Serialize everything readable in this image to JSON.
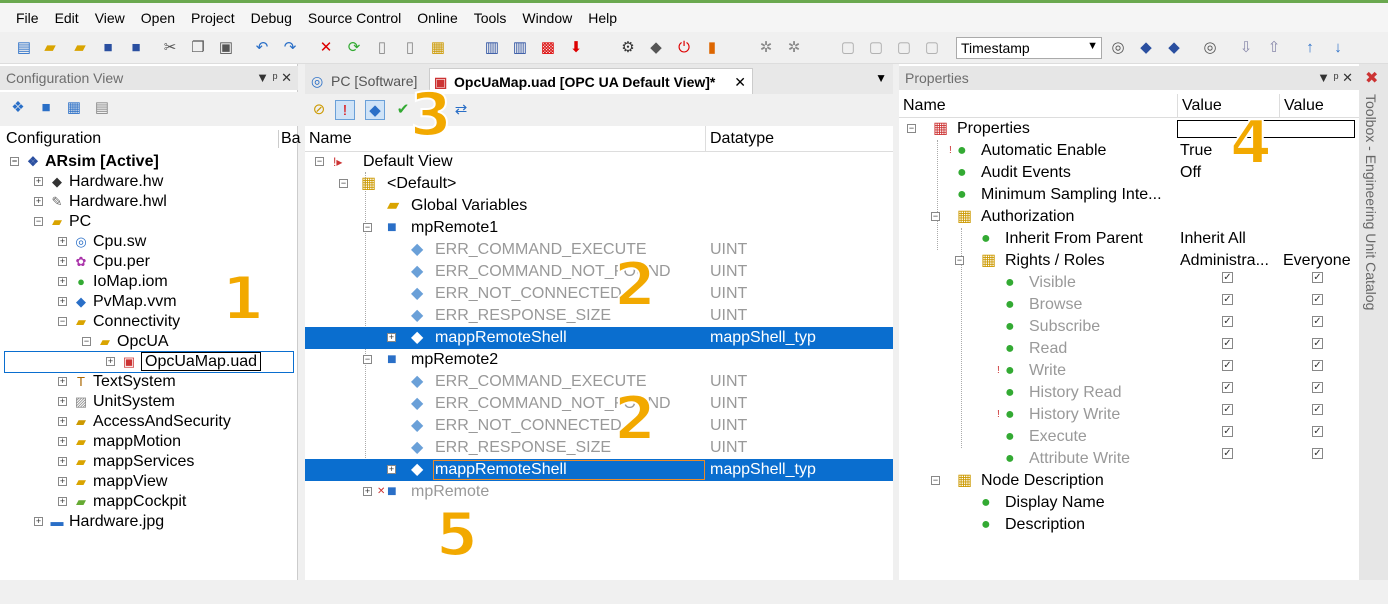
{
  "menu": [
    "File",
    "Edit",
    "View",
    "Open",
    "Project",
    "Debug",
    "Source Control",
    "Online",
    "Tools",
    "Window",
    "Help"
  ],
  "toolbar": {
    "timestamp": "Timestamp"
  },
  "config_view": {
    "title": "Configuration View",
    "col1": "Configuration",
    "col2": "Ba",
    "items": [
      {
        "label": "ARsim [Active]",
        "bold": true
      },
      {
        "label": "Hardware.hw"
      },
      {
        "label": "Hardware.hwl"
      },
      {
        "label": "PC"
      },
      {
        "label": "Cpu.sw"
      },
      {
        "label": "Cpu.per"
      },
      {
        "label": "IoMap.iom"
      },
      {
        "label": "PvMap.vvm"
      },
      {
        "label": "Connectivity"
      },
      {
        "label": "OpcUA"
      },
      {
        "label": "OpcUaMap.uad"
      },
      {
        "label": "TextSystem"
      },
      {
        "label": "UnitSystem"
      },
      {
        "label": "AccessAndSecurity"
      },
      {
        "label": "mappMotion"
      },
      {
        "label": "mappServices"
      },
      {
        "label": "mappView"
      },
      {
        "label": "mappCockpit"
      },
      {
        "label": "Hardware.jpg"
      }
    ]
  },
  "editor": {
    "tab1": "PC [Software]",
    "tab2": "OpcUaMap.uad [OPC UA Default View]*",
    "col_name": "Name",
    "col_type": "Datatype",
    "rows": [
      {
        "name": "Default View",
        "type": ""
      },
      {
        "name": "<Default>",
        "type": ""
      },
      {
        "name": "Global Variables",
        "type": ""
      },
      {
        "name": "mpRemote1",
        "type": ""
      },
      {
        "name": "ERR_COMMAND_EXECUTE",
        "type": "UINT"
      },
      {
        "name": "ERR_COMMAND_NOT_FOUND",
        "type": "UINT"
      },
      {
        "name": "ERR_NOT_CONNECTED",
        "type": "UINT"
      },
      {
        "name": "ERR_RESPONSE_SIZE",
        "type": "UINT"
      },
      {
        "name": "mappRemoteShell",
        "type": "mappShell_typ"
      },
      {
        "name": "mpRemote2",
        "type": ""
      },
      {
        "name": "ERR_COMMAND_EXECUTE",
        "type": "UINT"
      },
      {
        "name": "ERR_COMMAND_NOT_FOUND",
        "type": "UINT"
      },
      {
        "name": "ERR_NOT_CONNECTED",
        "type": "UINT"
      },
      {
        "name": "ERR_RESPONSE_SIZE",
        "type": "UINT"
      },
      {
        "name": "mappRemoteShell",
        "type": "mappShell_typ"
      },
      {
        "name": "mpRemote",
        "type": ""
      }
    ]
  },
  "properties": {
    "title": "Properties",
    "col_name": "Name",
    "col_value1": "Value",
    "col_value2": "Value",
    "rows": [
      {
        "name": "Properties",
        "v1": "",
        "v2": ""
      },
      {
        "name": "Automatic Enable",
        "v1": "True",
        "v2": ""
      },
      {
        "name": "Audit Events",
        "v1": "Off",
        "v2": ""
      },
      {
        "name": "Minimum Sampling Inte...",
        "v1": "",
        "v2": ""
      },
      {
        "name": "Authorization",
        "v1": "",
        "v2": ""
      },
      {
        "name": "Inherit From Parent",
        "v1": "Inherit All",
        "v2": ""
      },
      {
        "name": "Rights / Roles",
        "v1": "Administra...",
        "v2": "Everyone"
      },
      {
        "name": "Visible",
        "v1": "",
        "v2": ""
      },
      {
        "name": "Browse",
        "v1": "",
        "v2": ""
      },
      {
        "name": "Subscribe",
        "v1": "",
        "v2": ""
      },
      {
        "name": "Read",
        "v1": "",
        "v2": ""
      },
      {
        "name": "Write",
        "v1": "",
        "v2": ""
      },
      {
        "name": "History Read",
        "v1": "",
        "v2": ""
      },
      {
        "name": "History Write",
        "v1": "",
        "v2": ""
      },
      {
        "name": "Execute",
        "v1": "",
        "v2": ""
      },
      {
        "name": "Attribute Write",
        "v1": "",
        "v2": ""
      },
      {
        "name": "Node Description",
        "v1": "",
        "v2": ""
      },
      {
        "name": "Display Name",
        "v1": "",
        "v2": ""
      },
      {
        "name": "Description",
        "v1": "",
        "v2": ""
      }
    ]
  },
  "sidebar": {
    "label": "Toolbox - Engineering Unit Catalog"
  },
  "callouts": [
    "1",
    "2",
    "2",
    "3",
    "4",
    "5"
  ]
}
